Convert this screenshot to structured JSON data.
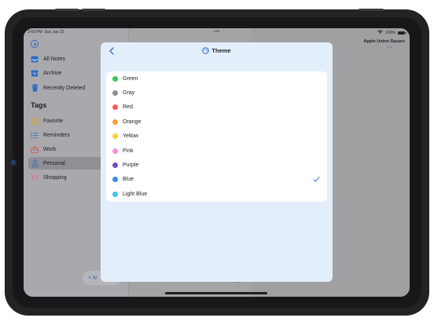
{
  "status_bar": {
    "time": "2:42 PM",
    "date": "Sun Jan 22",
    "battery": "100%"
  },
  "sidebar": {
    "items": [
      {
        "label": "All Notes",
        "icon": "tray-icon"
      },
      {
        "label": "Archive",
        "icon": "archive-icon"
      },
      {
        "label": "Recently Deleted",
        "icon": "trash-icon"
      }
    ],
    "tags_heading": "Tags",
    "tags": [
      {
        "label": "Favorite",
        "icon": "star-icon",
        "color": "#d9a21b"
      },
      {
        "label": "Reminders",
        "icon": "list-icon",
        "color": "#2f6cc0"
      },
      {
        "label": "Work",
        "icon": "briefcase-icon",
        "color": "#d9534f"
      },
      {
        "label": "Personal",
        "icon": "person-icon",
        "color": "#2f6cc0",
        "selected": true
      },
      {
        "label": "Shopping",
        "icon": "cart-icon",
        "color": "#d96aa7"
      }
    ],
    "new_button_label": "+ N"
  },
  "right_pane": {
    "title": "Apple Union Square"
  },
  "modal": {
    "title": "Theme",
    "back_label": "<",
    "selected_theme": "Blue",
    "themes": [
      {
        "name": "Green",
        "color": "#34c759"
      },
      {
        "name": "Gray",
        "color": "#8e8e93"
      },
      {
        "name": "Red",
        "color": "#ff5a55"
      },
      {
        "name": "Orange",
        "color": "#ff9f3a"
      },
      {
        "name": "Yellow",
        "color": "#ffcc33"
      },
      {
        "name": "Pink",
        "color": "#ff8fd8"
      },
      {
        "name": "Purple",
        "color": "#6f4fbf"
      },
      {
        "name": "Blue",
        "color": "#3b8ee8"
      },
      {
        "name": "Light Blue",
        "color": "#40c5ea"
      }
    ]
  },
  "colors": {
    "accent": "#2f6cc0",
    "modal_bg": "#e3eefb"
  }
}
